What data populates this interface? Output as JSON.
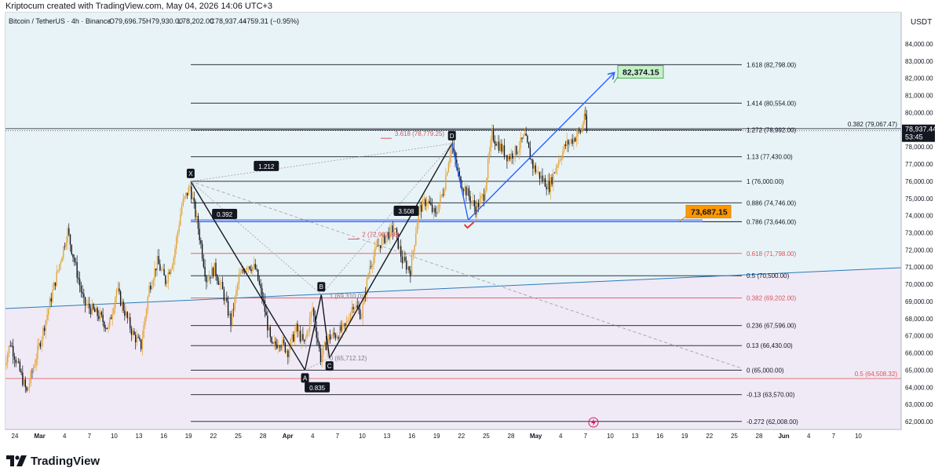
{
  "header": {
    "caption": "Kriptocum created with TradingView.com, May 04, 2026 14:06 UTC+3"
  },
  "legend": {
    "symbol": "Bitcoin / TetherUS · 4h · Binance",
    "o_label": "O",
    "o": "79,696.75",
    "h_label": "H",
    "h": "79,930.00",
    "l_label": "L",
    "l": "78,202.00",
    "c_label": "C",
    "c": "78,937.44",
    "change": "−759.31 (−0.95%)"
  },
  "price_scale": {
    "currency": "USDT",
    "last_price": "78,937.44",
    "countdown": "53:45"
  },
  "footer": {
    "brand": "TradingView"
  },
  "colors": {
    "up": "#e4a437",
    "down": "#131722",
    "fib_red": "#e0525b",
    "blue": "#2962ff",
    "target_box": "#c6f0c8",
    "orange_box": "#ff9800",
    "upper_bg": "#e8f3f8",
    "lower_bg": "#efeaf6"
  },
  "chart_data": {
    "type": "candlestick",
    "title": "Bitcoin / TetherUS · 4h · Binance",
    "ylim": [
      61800,
      84600
    ],
    "y_ticks": [
      84000,
      83000,
      82000,
      81000,
      80000,
      79000,
      78000,
      77000,
      76000,
      75000,
      74000,
      73000,
      72000,
      71000,
      70000,
      69000,
      68000,
      67000,
      66000,
      65000,
      64000,
      63000,
      62000
    ],
    "x_tick_labels": [
      "24",
      "Mar",
      "4",
      "7",
      "10",
      "13",
      "16",
      "19",
      "22",
      "25",
      "28",
      "Apr",
      "4",
      "7",
      "10",
      "13",
      "16",
      "19",
      "22",
      "25",
      "28",
      "May",
      "4",
      "7",
      "10",
      "13",
      "16",
      "19",
      "22",
      "25",
      "28",
      "Jun",
      "4",
      "7",
      "10"
    ],
    "path_points": [
      {
        "d": "Feb 22",
        "p": 64900
      },
      {
        "d": "Feb 23",
        "p": 66600
      },
      {
        "d": "Feb 25",
        "p": 63700
      },
      {
        "d": "Feb 27",
        "p": 67300
      },
      {
        "d": "Mar 2",
        "p": 73100
      },
      {
        "d": "Mar 3",
        "p": 71000
      },
      {
        "d": "Mar 4",
        "p": 68900
      },
      {
        "d": "Mar 6",
        "p": 68100
      },
      {
        "d": "Mar 7",
        "p": 67400
      },
      {
        "d": "Mar 8",
        "p": 69700
      },
      {
        "d": "Mar 10",
        "p": 67100
      },
      {
        "d": "Mar 11",
        "p": 66400
      },
      {
        "d": "Mar 12",
        "p": 69800
      },
      {
        "d": "Mar 13",
        "p": 71300
      },
      {
        "d": "Mar 14",
        "p": 70200
      },
      {
        "d": "Mar 15",
        "p": 71600
      },
      {
        "d": "Mar 16",
        "p": 74600
      },
      {
        "d": "Mar 17",
        "p": 75700
      },
      {
        "d": "Mar 18",
        "p": 73300
      },
      {
        "d": "Mar 19",
        "p": 70300
      },
      {
        "d": "Mar 20",
        "p": 70900
      },
      {
        "d": "Mar 21",
        "p": 69600
      },
      {
        "d": "Mar 22",
        "p": 67800
      },
      {
        "d": "Mar 23",
        "p": 70400
      },
      {
        "d": "Mar 24",
        "p": 71200
      },
      {
        "d": "Mar 25",
        "p": 70900
      },
      {
        "d": "Mar 26",
        "p": 68900
      },
      {
        "d": "Mar 27",
        "p": 66300
      },
      {
        "d": "Mar 28",
        "p": 66700
      },
      {
        "d": "Mar 29",
        "p": 66100
      },
      {
        "d": "Mar 30",
        "p": 67400
      },
      {
        "d": "Mar 31",
        "p": 66500
      },
      {
        "d": "Apr 1",
        "p": 68600
      },
      {
        "d": "Apr 2",
        "p": 65700
      },
      {
        "d": "Apr 3",
        "p": 66900
      },
      {
        "d": "Apr 4",
        "p": 67100
      },
      {
        "d": "Apr 5",
        "p": 67500
      },
      {
        "d": "Apr 6",
        "p": 68900
      },
      {
        "d": "Apr 7",
        "p": 68200
      },
      {
        "d": "Apr 8",
        "p": 71100
      },
      {
        "d": "Apr 9",
        "p": 72200
      },
      {
        "d": "Apr 10",
        "p": 72800
      },
      {
        "d": "Apr 11",
        "p": 73300
      },
      {
        "d": "Apr 12",
        "p": 71400
      },
      {
        "d": "Apr 13",
        "p": 70800
      },
      {
        "d": "Apr 14",
        "p": 74300
      },
      {
        "d": "Apr 15",
        "p": 74900
      },
      {
        "d": "Apr 16",
        "p": 74000
      },
      {
        "d": "Apr 17",
        "p": 75400
      },
      {
        "d": "Apr 18",
        "p": 78200
      },
      {
        "d": "Apr 19",
        "p": 76100
      },
      {
        "d": "Apr 20",
        "p": 75300
      },
      {
        "d": "Apr 21",
        "p": 74400
      },
      {
        "d": "Apr 22",
        "p": 75200
      },
      {
        "d": "Apr 23",
        "p": 78700
      },
      {
        "d": "Apr 24",
        "p": 78000
      },
      {
        "d": "Apr 25",
        "p": 77400
      },
      {
        "d": "Apr 26",
        "p": 77800
      },
      {
        "d": "Apr 27",
        "p": 78600
      },
      {
        "d": "Apr 28",
        "p": 76900
      },
      {
        "d": "Apr 29",
        "p": 76200
      },
      {
        "d": "Apr 30",
        "p": 75700
      },
      {
        "d": "May 1",
        "p": 77100
      },
      {
        "d": "May 2",
        "p": 78100
      },
      {
        "d": "May 3",
        "p": 78500
      },
      {
        "d": "May 4",
        "p": 79000
      },
      {
        "d": "May 4",
        "p": 80000
      },
      {
        "d": "May 4",
        "p": 78937.44
      }
    ],
    "fib_levels": [
      {
        "label": "1.618 (82,798.00)",
        "price": 82798,
        "color": "black"
      },
      {
        "label": "1.414 (80,554.00)",
        "price": 80554,
        "color": "black"
      },
      {
        "label": "1.272 (78,992.00)",
        "price": 78992,
        "color": "black"
      },
      {
        "label": "1.13 (77,430.00)",
        "price": 77430,
        "color": "black"
      },
      {
        "label": "1 (76,000.00)",
        "price": 76000,
        "color": "black"
      },
      {
        "label": "0.886 (74,746.00)",
        "price": 74746,
        "color": "black"
      },
      {
        "label": "0.786 (73,646.00)",
        "price": 73646,
        "color": "black"
      },
      {
        "label": "0.618 (71,798.00)",
        "price": 71798,
        "color": "red"
      },
      {
        "label": "0.5 (70,500.00)",
        "price": 70500,
        "color": "black"
      },
      {
        "label": "0.382 (69,202.00)",
        "price": 69202,
        "color": "red"
      },
      {
        "label": "0.236 (67,596.00)",
        "price": 67596,
        "color": "black"
      },
      {
        "label": "0.13 (66,430.00)",
        "price": 66430,
        "color": "black"
      },
      {
        "label": "0 (65,000.00)",
        "price": 65000,
        "color": "black"
      },
      {
        "label": "-0.13 (63,570.00)",
        "price": 63570,
        "color": "black"
      },
      {
        "label": "-0.272 (62,008.00)",
        "price": 62008,
        "color": "black"
      }
    ],
    "right_levels": [
      {
        "label": "0.382 (79,067.47)",
        "price": 79067.47,
        "color": "black"
      },
      {
        "label": "0.5 (64,508.32)",
        "price": 64508.32,
        "color": "red"
      }
    ],
    "harmonic": {
      "points": [
        {
          "name": "X",
          "date": "Mar 17",
          "price": 76000
        },
        {
          "name": "A",
          "date": "Mar 31",
          "price": 65000
        },
        {
          "name": "B",
          "date": "Apr 2",
          "price": 69400
        },
        {
          "name": "C",
          "date": "Apr 3",
          "price": 65700
        },
        {
          "name": "D",
          "date": "Apr 18",
          "price": 78200
        }
      ],
      "ratios": [
        "1.212",
        "0.392",
        "3.508",
        "0.835"
      ]
    },
    "other_labels": [
      {
        "text": "3.618 (78,779.25)",
        "date": "Apr 11",
        "price": 78779,
        "color": "red"
      },
      {
        "text": "2 (72,907.88)",
        "date": "Apr 7",
        "price": 72908,
        "color": "red"
      },
      {
        "text": "1 (69,310.0)",
        "date": "Apr 3",
        "price": 69310,
        "color": "gray"
      },
      {
        "text": "0 (65,712.12)",
        "date": "Apr 3",
        "price": 65712,
        "color": "gray"
      }
    ],
    "targets": [
      {
        "label": "82,374.15",
        "price": 82374.15,
        "kind": "projection"
      },
      {
        "label": "73,687.15",
        "price": 73687.15,
        "kind": "support"
      }
    ]
  }
}
